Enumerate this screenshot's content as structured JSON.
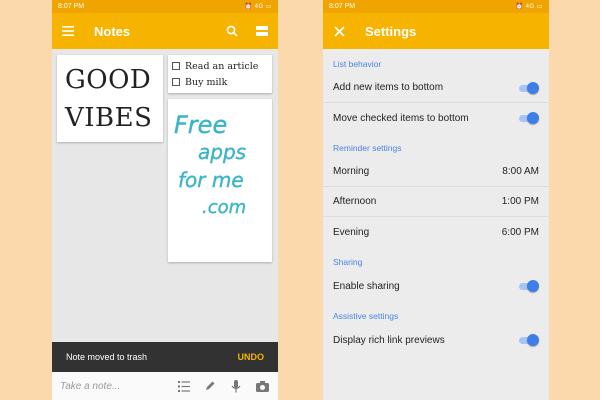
{
  "left_phone": {
    "status": {
      "time": "8:07 PM",
      "network": "4G"
    },
    "appbar": {
      "title": "Notes"
    },
    "notes": {
      "good_vibes": [
        "GOOD",
        "VIBES"
      ],
      "checklist": [
        {
          "label": "Read an article",
          "checked": false
        },
        {
          "label": "Buy milk",
          "checked": false
        }
      ],
      "drawing": {
        "lines": [
          "Free",
          "apps",
          "for me",
          ".com"
        ],
        "ink_color": "#3bb5c6"
      }
    },
    "snackbar": {
      "message": "Note moved to trash",
      "action": "UNDO"
    },
    "bottombar": {
      "placeholder": "Take a note...",
      "icons": [
        "list-icon",
        "pen-icon",
        "mic-icon",
        "camera-icon"
      ]
    }
  },
  "right_phone": {
    "status": {
      "time": "8:07 PM",
      "network": "4G"
    },
    "appbar": {
      "title": "Settings"
    },
    "sections": {
      "list_behavior": {
        "header": "List behavior",
        "rows": [
          {
            "label": "Add new items to bottom",
            "enabled": true
          },
          {
            "label": "Move checked items to bottom",
            "enabled": true
          }
        ]
      },
      "reminders": {
        "header": "Reminder settings",
        "rows": [
          {
            "label": "Morning",
            "value": "8:00 AM"
          },
          {
            "label": "Afternoon",
            "value": "1:00 PM"
          },
          {
            "label": "Evening",
            "value": "6:00 PM"
          }
        ]
      },
      "sharing": {
        "header": "Sharing",
        "rows": [
          {
            "label": "Enable sharing",
            "enabled": true
          }
        ]
      },
      "assistive": {
        "header": "Assistive settings",
        "rows": [
          {
            "label": "Display rich link previews",
            "enabled": true
          }
        ]
      }
    }
  },
  "colors": {
    "background": "#fcd9ac",
    "appbar": "#f6b400",
    "accent_blue": "#3d7fe6",
    "undo": "#f6b400"
  }
}
